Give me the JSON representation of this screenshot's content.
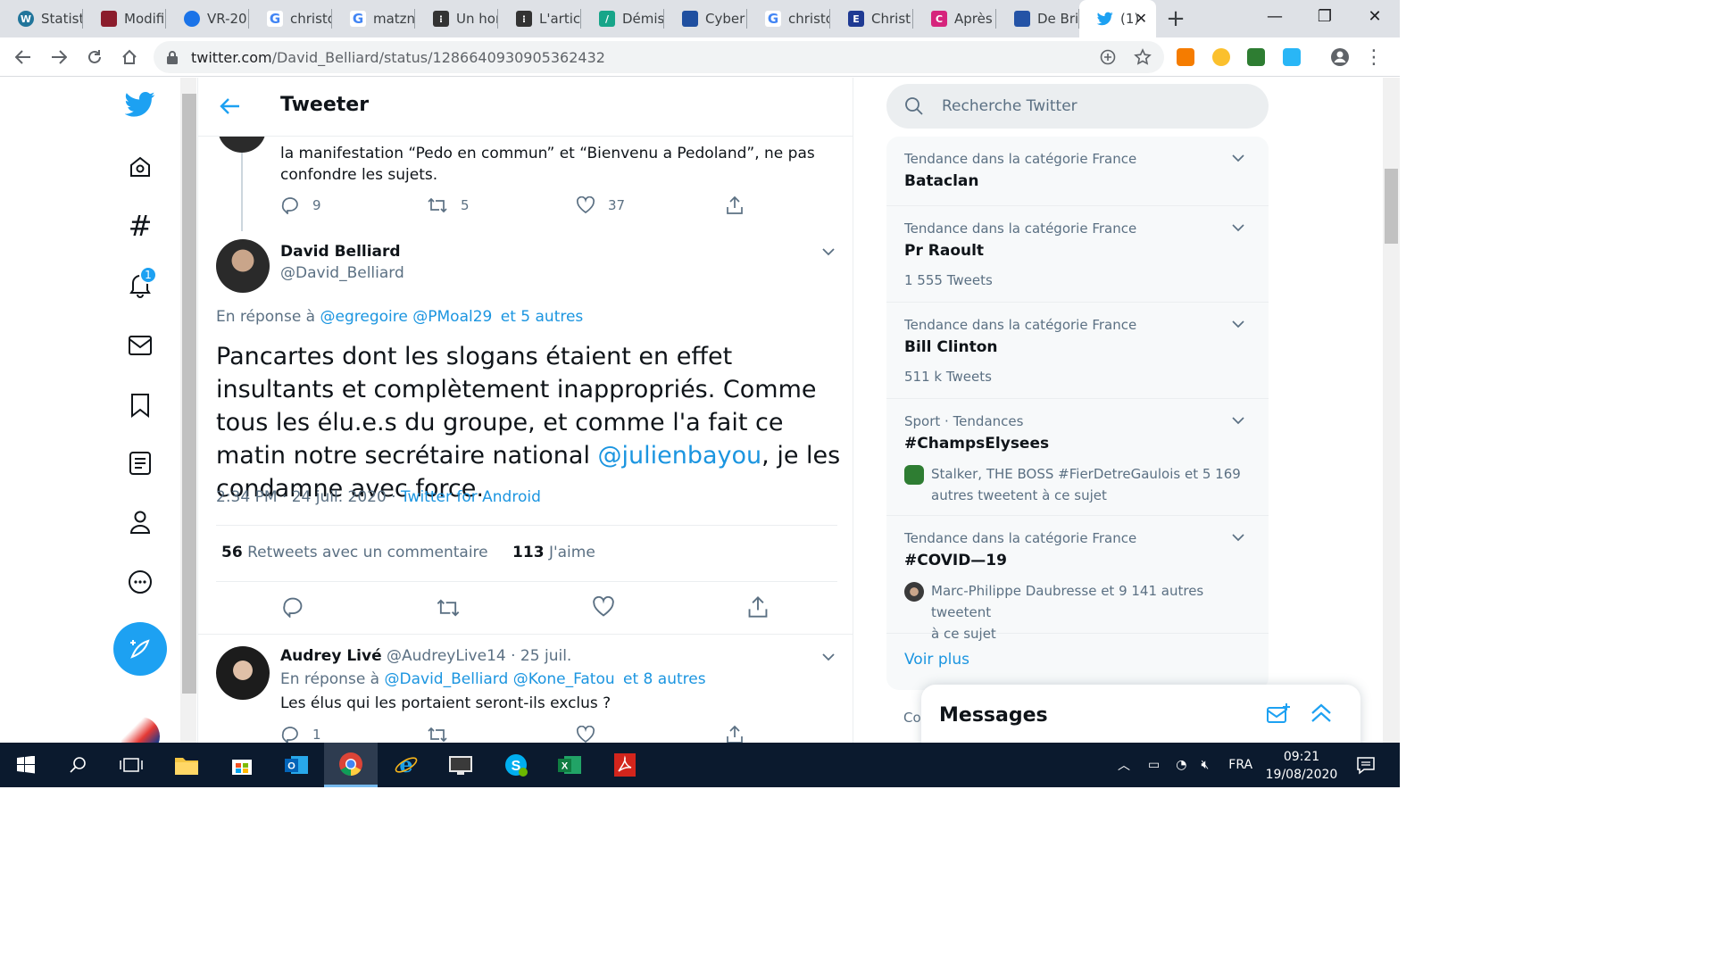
{
  "browser": {
    "tabs": [
      {
        "label": "Statisti",
        "icon": "wordpress-icon",
        "color": "#21759b"
      },
      {
        "label": "Modifi",
        "icon": "flag-icon",
        "color": "#8b1c2c"
      },
      {
        "label": "VR-20",
        "icon": "cloud-icon",
        "color": "#1a73e8"
      },
      {
        "label": "christo",
        "icon": "google-icon",
        "color": "#4285f4"
      },
      {
        "label": "matzn",
        "icon": "google-icon",
        "color": "#4285f4"
      },
      {
        "label": "Un hor",
        "icon": "square-icon",
        "color": "#333333"
      },
      {
        "label": "L'artic",
        "icon": "square-icon",
        "color": "#333333"
      },
      {
        "label": "Démis",
        "icon": "bars-icon",
        "color": "#17a589"
      },
      {
        "label": "Cyber",
        "icon": "square-icon",
        "color": "#1f4fa0"
      },
      {
        "label": "christo",
        "icon": "google-icon",
        "color": "#4285f4"
      },
      {
        "label": "Christ",
        "icon": "square-icon",
        "color": "#1f3a93"
      },
      {
        "label": "Après",
        "icon": "square-icon",
        "color": "#d6247c"
      },
      {
        "label": "De Bri",
        "icon": "square-icon",
        "color": "#2453a6"
      },
      {
        "label": "(1)",
        "icon": "twitter-icon",
        "color": "#1da1f2",
        "active": true
      }
    ],
    "url_domain": "twitter.com",
    "url_path": "/David_Belliard/status/1286640930905362432"
  },
  "nav": {
    "notification_count": "1"
  },
  "header": {
    "title": "Tweeter"
  },
  "parent_tweet": {
    "text_line1": "la manifestation “Pedo en commun” et “Bienvenu a Pedoland”, ne pas",
    "text_line2": "confondre les sujets.",
    "replies": "9",
    "retweets": "5",
    "likes": "37"
  },
  "main_tweet": {
    "name": "David Belliard",
    "handle": "@David_Belliard",
    "reply_prefix": "En réponse à",
    "reply_to_1": "@egregoire",
    "reply_to_2": "@PMoal29",
    "reply_others": "et 5 autres",
    "text_before": "Pancartes dont les slogans étaient en effet insultants et complètement inappropriés. Comme tous les élu.e.s du groupe, et comme l'a fait ce matin notre secrétaire national ",
    "mention": "@julienbayou",
    "text_after": ", je les condamne avec force.",
    "timestamp": "2:34 PM · 24 juil. 2020 · ",
    "source": "Twitter for Android",
    "retweets_count": "56",
    "retweets_label": "Retweets avec un commentaire",
    "likes_count": "113",
    "likes_label": "J'aime"
  },
  "reply_tweet": {
    "name": "Audrey Livé",
    "handle": "@AudreyLive14",
    "date": "· 25 juil.",
    "reply_prefix": "En réponse à",
    "reply_to_1": "@David_Belliard",
    "reply_to_2": "@Kone_Fatou",
    "reply_others": "et 8 autres",
    "text": "Les élus qui les portaient seront-ils exclus ?",
    "replies": "1"
  },
  "sidebar": {
    "search_placeholder": "Recherche Twitter",
    "trends": [
      {
        "category": "Tendance dans la catégorie France",
        "name": "Bataclan",
        "meta": ""
      },
      {
        "category": "Tendance dans la catégorie France",
        "name": "Pr Raoult",
        "meta": "1 555 Tweets"
      },
      {
        "category": "Tendance dans la catégorie France",
        "name": "Bill Clinton",
        "meta": "511 k Tweets"
      },
      {
        "category": "Sport · Tendances",
        "name": "#ChampsElysees",
        "desc_line1": "Stalker, THE BOSS #FierDetreGaulois et 5 169",
        "desc_line2": "autres tweetent à ce sujet"
      },
      {
        "category": "Tendance dans la catégorie France",
        "name": "#COVID—19",
        "desc_line1": "Marc-Philippe Daubresse et 9 141 autres tweetent",
        "desc_line2": "à ce sujet"
      }
    ],
    "see_more": "Voir plus",
    "messages_title": "Messages",
    "footer_partial": "Co"
  },
  "taskbar": {
    "language": "FRA",
    "time": "09:21",
    "date": "19/08/2020"
  },
  "colors": {
    "twitter_blue": "#1da1f2",
    "link_blue": "#1b95e0",
    "muted": "#5b7083"
  }
}
